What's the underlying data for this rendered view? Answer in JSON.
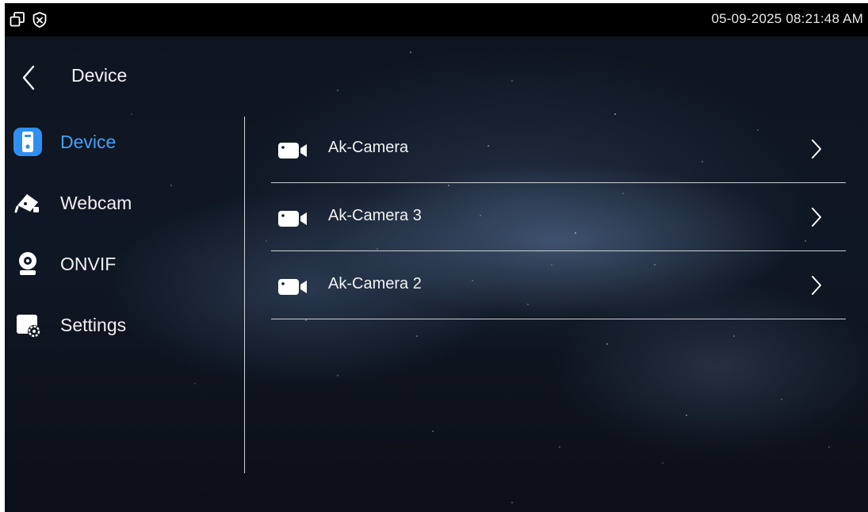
{
  "status_bar": {
    "datetime": "05-09-2025 08:21:48 AM",
    "icons": [
      "window-restore-icon",
      "shield-x-icon"
    ]
  },
  "header": {
    "back_icon": "chevron-left-icon",
    "title": "Device"
  },
  "sidebar": {
    "items": [
      {
        "label": "Device",
        "icon": "intercom-device-icon",
        "active": true
      },
      {
        "label": "Webcam",
        "icon": "security-camera-icon",
        "active": false
      },
      {
        "label": "ONVIF",
        "icon": "webcam-icon",
        "active": false
      },
      {
        "label": "Settings",
        "icon": "camera-settings-icon",
        "active": false
      }
    ]
  },
  "device_list": [
    {
      "name": "Ak-Camera",
      "icon": "video-camera-icon"
    },
    {
      "name": "Ak-Camera 3",
      "icon": "video-camera-icon"
    },
    {
      "name": "Ak-Camera 2",
      "icon": "video-camera-icon"
    }
  ],
  "colors": {
    "accent": "#3fa2ff",
    "active_icon_bg": "#2f8ff0",
    "status_bar": "#000000",
    "background": "#101724"
  }
}
